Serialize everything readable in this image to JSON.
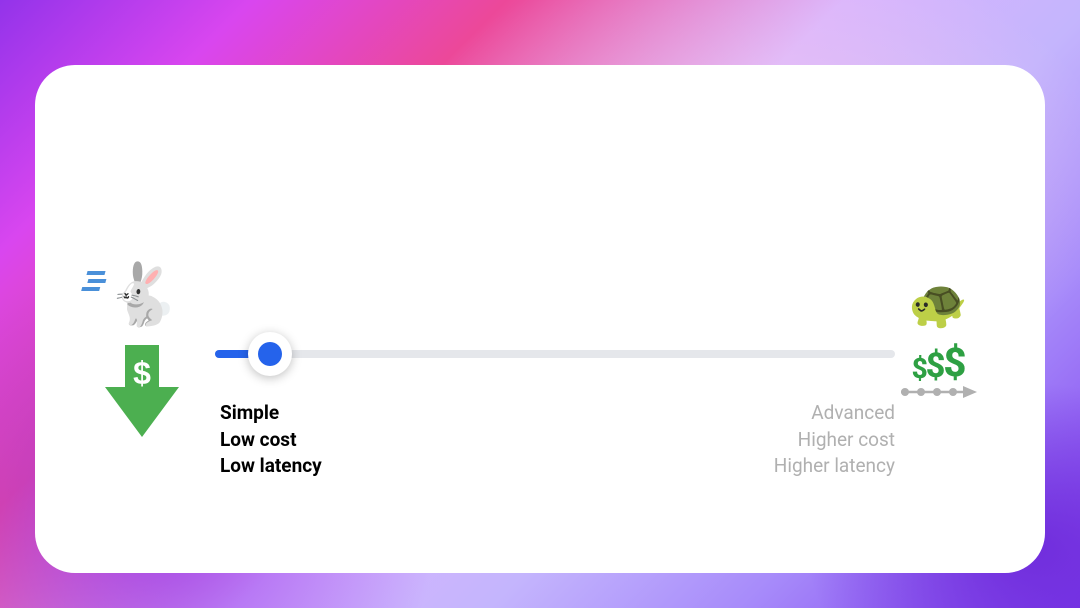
{
  "left": {
    "line1": "Simple",
    "line2": "Low cost",
    "line3": "Low latency",
    "money_symbol": "$"
  },
  "right": {
    "line1": "Advanced",
    "line2": "Higher cost",
    "line3": "Higher latency",
    "money_symbols": {
      "a": "$",
      "b": "$",
      "c": "$"
    }
  },
  "slider": {
    "position_percent": 8
  }
}
